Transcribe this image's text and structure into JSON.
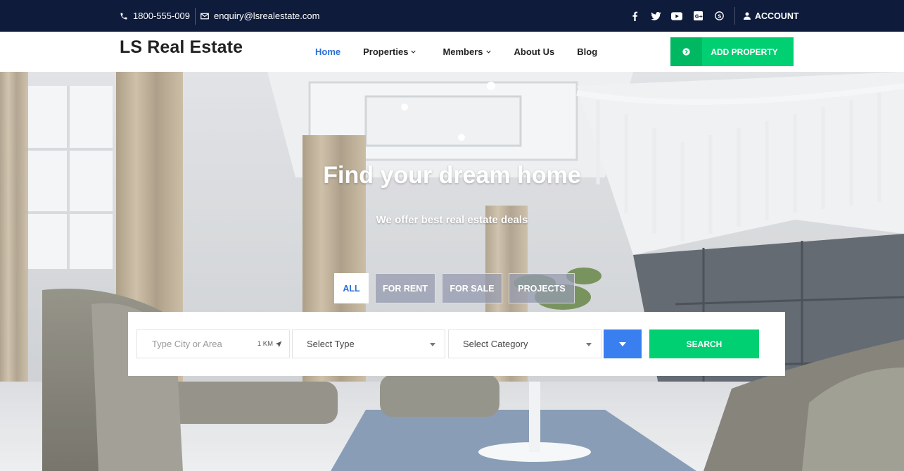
{
  "topbar": {
    "phone": "1800-555-009",
    "email": "enquiry@lsrealestate.com",
    "social_icons": [
      "facebook-icon",
      "twitter-icon",
      "youtube-icon",
      "google-plus-icon",
      "skype-icon"
    ],
    "account_label": "ACCOUNT",
    "background": "#0e1b3b"
  },
  "nav": {
    "brand": "LS Real Estate",
    "items": [
      {
        "label": "Home",
        "active": true
      },
      {
        "label": "Properties",
        "dropdown": true
      },
      {
        "label": "Members",
        "dropdown": true
      },
      {
        "label": "About Us"
      },
      {
        "label": "Blog"
      }
    ],
    "add_property_label": "ADD PROPERTY",
    "accent": "#00d072",
    "link_active_color": "#2b6fd6"
  },
  "hero": {
    "title": "Find your dream home",
    "subtitle": "We offer best real estate deals",
    "tabs": [
      "ALL",
      "FOR RENT",
      "FOR SALE",
      "PROJECTS"
    ],
    "active_tab": "ALL"
  },
  "search": {
    "city_placeholder": "Type City or Area",
    "radius": "1 KM",
    "type_value": "Select Type",
    "category_value": "Select Category",
    "search_label": "SEARCH",
    "advanced_color": "#3a7ff0"
  }
}
